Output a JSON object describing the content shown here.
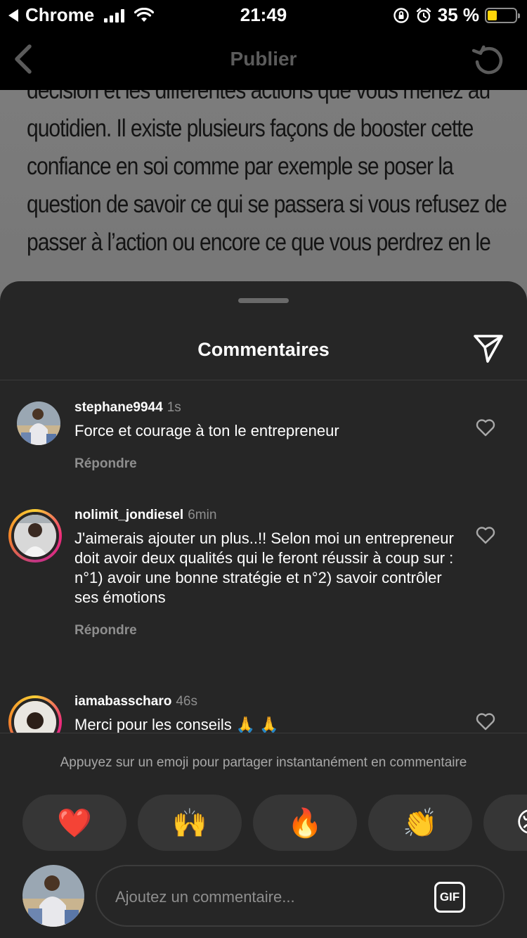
{
  "status_bar": {
    "back_app": "Chrome",
    "time": "21:49",
    "battery": "35 %",
    "battery_level": 0.35
  },
  "nav": {
    "title": "Publier"
  },
  "article": {
    "lines": [
      "décision et les différentes actions que vous menez au",
      "quotidien. Il existe plusieurs façons de booster cette",
      "confiance en soi comme par exemple  se poser la",
      "question de savoir ce qui se passera  si vous refusez de",
      "passer à l’action ou encore ce que  vous perdrez en le"
    ]
  },
  "sheet": {
    "title": "Commentaires"
  },
  "comments": [
    {
      "username": "stephane9944",
      "time": "1s",
      "text": "Force et courage à ton le entrepreneur",
      "reply": "Répondre",
      "has_story": false
    },
    {
      "username": "nolimit_jondiesel",
      "time": "6min",
      "text": "J'aimerais ajouter un plus..!! Selon moi un entrepreneur doit avoir deux qualités qui le feront réussir à coup sur : n°1) avoir une bonne stratégie et n°2) savoir contrôler ses émotions",
      "reply": "Répondre",
      "has_story": true
    },
    {
      "username": "iamabasscharo",
      "time": "46s",
      "text": "Merci pour les conseils 🙏 🙏",
      "reply": "",
      "has_story": true
    }
  ],
  "emoji_hint": "Appuyez sur un emoji pour partager instantanément en commentaire",
  "emojis": [
    "❤️",
    "🙌",
    "🔥",
    "👏",
    "😢"
  ],
  "composer": {
    "placeholder": "Ajoutez un commentaire...",
    "gif_label": "GIF"
  },
  "colors": {
    "sheet_bg": "#262626",
    "muted_text": "#8e8e8e",
    "battery_fill": "#ffd60a",
    "nav_title": "#5b5b5b"
  }
}
